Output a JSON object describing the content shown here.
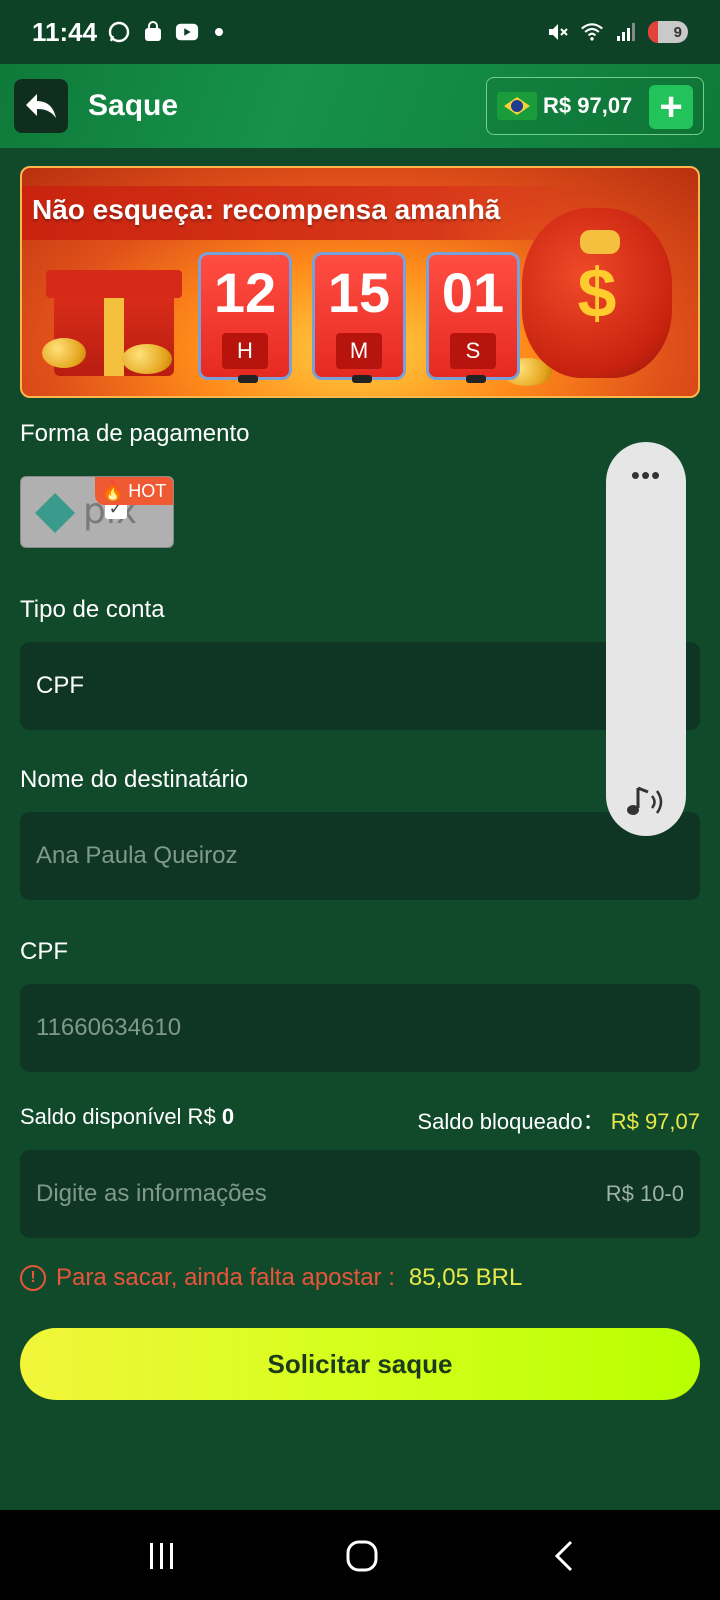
{
  "status_bar": {
    "time": "11:44",
    "battery": "9",
    "icons": [
      "whatsapp-icon",
      "shopping-bag-icon",
      "youtube-icon",
      "mute-icon",
      "wifi-icon",
      "signal-icon",
      "battery-icon"
    ]
  },
  "header": {
    "title": "Saque",
    "balance": "R$ 97,07",
    "add_label": "+"
  },
  "banner": {
    "title": "Não esqueça: recompensa amanhã",
    "timer": [
      {
        "value": "12",
        "unit": "H"
      },
      {
        "value": "15",
        "unit": "M"
      },
      {
        "value": "01",
        "unit": "S"
      }
    ]
  },
  "form": {
    "payment_label": "Forma de pagamento",
    "payment_method": {
      "name": "pix",
      "badge": "HOT"
    },
    "account_type_label": "Tipo de conta",
    "account_type_value": "CPF",
    "recipient_label": "Nome do destinatário",
    "recipient_value": "Ana Paula Queiroz",
    "cpf_label": "CPF",
    "cpf_value": "11660634610",
    "available_label": "Saldo disponível R$",
    "available_value": "0",
    "blocked_label": "Saldo bloqueado：",
    "blocked_value": "R$ 97,07",
    "amount_placeholder": "Digite as informações",
    "amount_range": "R$ 10-0",
    "warning_text": "Para sacar, ainda falta apostar :",
    "warning_amount": "85,05 BRL",
    "submit_label": "Solicitar saque"
  },
  "float_panel": {
    "menu": "•••"
  },
  "colors": {
    "background": "#114a2b",
    "header": "#16924a",
    "field": "#0f3524",
    "accent_yellow": "#e8e84a",
    "warning_red": "#e8553a",
    "button_start": "#f2f53a",
    "button_end": "#b8ff00"
  }
}
